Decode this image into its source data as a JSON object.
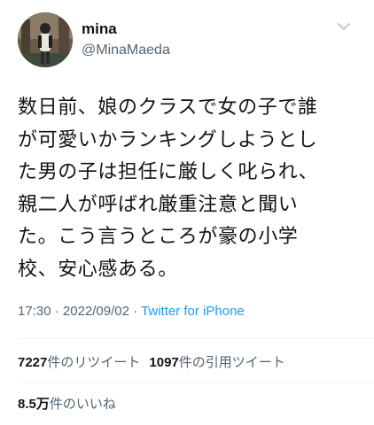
{
  "user": {
    "display_name": "mina",
    "handle": "@MinaMaeda",
    "avatar_icon": "profile-photo",
    "more_icon": "chevron-down-icon"
  },
  "tweet": {
    "text": "数日前、娘のクラスで女の子で誰\nが可愛いかランキングしようとし\nた男の子は担任に厳しく叱られ、\n親二人が呼ばれ厳重注意と聞い\nた。こう言うところが豪の小学\n校、安心感ある。",
    "time": "17:30",
    "separator": "·",
    "date": "2022/09/02",
    "source": "Twitter for iPhone"
  },
  "stats": {
    "retweets_count": "7227",
    "retweets_label": "件のリツイート",
    "quotes_count": "1097",
    "quotes_label": "件の引用ツイート",
    "likes_count": "8.5",
    "likes_unit": "万",
    "likes_label": "件のいいね"
  },
  "colors": {
    "text": "#0f1419",
    "secondary": "#536471",
    "link": "#1d9bf0",
    "divider": "#eff3f4"
  }
}
